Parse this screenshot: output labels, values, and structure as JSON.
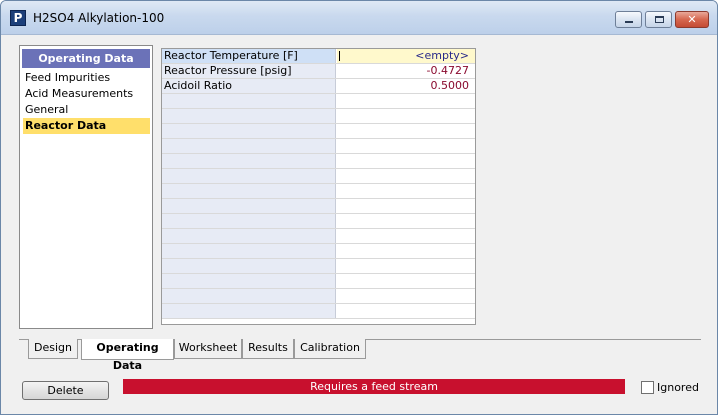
{
  "window": {
    "title": "H2SO4 Alkylation-100",
    "icon": "P",
    "controls": {
      "minimize": "minimize-icon",
      "maximize": "maximize-icon",
      "close": "✕"
    }
  },
  "nav": {
    "header": "Operating Data",
    "items": [
      {
        "label": "Feed Impurities",
        "selected": false
      },
      {
        "label": "Acid Measurements",
        "selected": false
      },
      {
        "label": "General",
        "selected": false
      },
      {
        "label": "Reactor Data",
        "selected": true
      }
    ]
  },
  "grid": {
    "rows": [
      {
        "label": "Reactor Temperature [F]",
        "value": "<empty>"
      },
      {
        "label": "Reactor Pressure [psig]",
        "value": "-0.4727"
      },
      {
        "label": "Acidoil Ratio",
        "value": "0.5000"
      }
    ],
    "empty_rows": 15
  },
  "tabs": [
    {
      "label": "Design",
      "active": false
    },
    {
      "label": "Operating Data",
      "active": true
    },
    {
      "label": "Worksheet",
      "active": false
    },
    {
      "label": "Results",
      "active": false
    },
    {
      "label": "Calibration",
      "active": false
    }
  ],
  "footer": {
    "delete_label": "Delete",
    "status_text": "Requires a feed stream",
    "status_color": "#c8102e",
    "ignored_label": "Ignored",
    "ignored_checked": false
  }
}
